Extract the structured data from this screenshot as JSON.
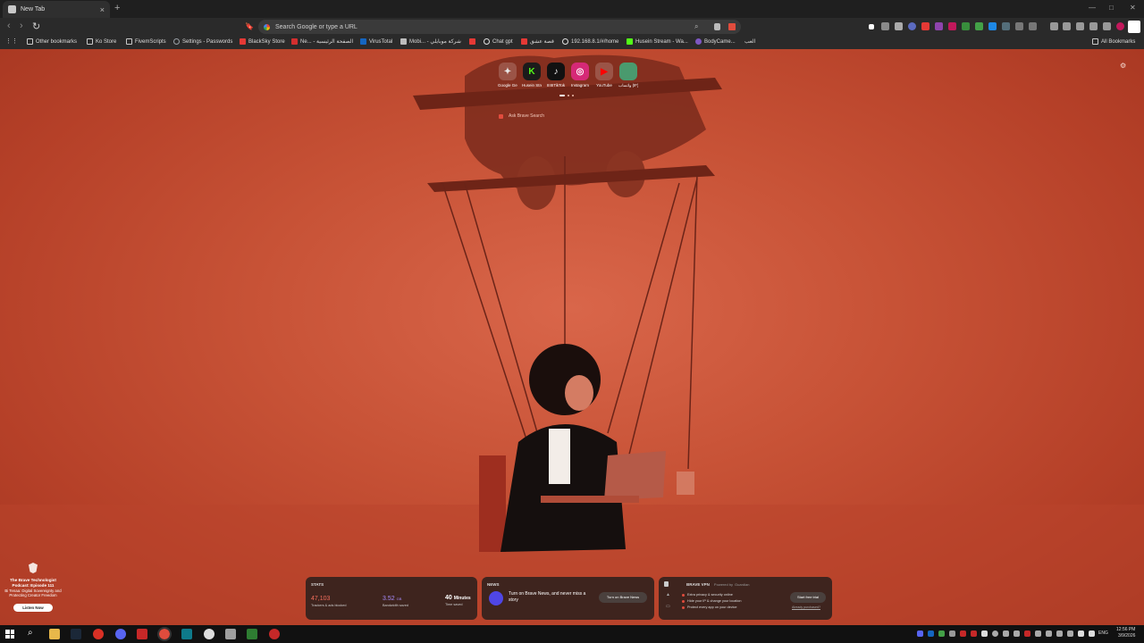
{
  "window": {
    "tab_title": "New Tab",
    "new_tab_symbol": "+",
    "close_symbol": "×",
    "min_symbol": "—",
    "max_symbol": "□",
    "win_close_symbol": "✕"
  },
  "toolbar": {
    "back_symbol": "‹",
    "forward_symbol": "›",
    "reload_symbol": "↻",
    "bookmark_symbol": "🔖",
    "omnibox_placeholder": "Search Google or type a URL"
  },
  "bookmarks": {
    "apps_symbol": "⋮⋮",
    "items": [
      {
        "label": "Other bookmarks",
        "color": "#c9c9c9"
      },
      {
        "label": "Ko Store",
        "color": "#c9c9c9"
      },
      {
        "label": "FivemScripts",
        "color": "#c9c9c9"
      },
      {
        "label": "Settings - Passwords",
        "color": "#9aa0a6"
      },
      {
        "label": "BlackSky Store",
        "color": "#e53935"
      },
      {
        "label": "Ne... - الصفحة الرئيسية",
        "color": "#d32f2f"
      },
      {
        "label": "VirusTotal",
        "color": "#1565c0"
      },
      {
        "label": "Mobi... - شركة موبايلي",
        "color": "#bdbdbd"
      },
      {
        "label": "",
        "color": "#e53935"
      },
      {
        "label": "Chat gpt",
        "color": "#e0e0e0"
      },
      {
        "label": "قصة عشق",
        "color": "#e53935"
      },
      {
        "label": "192.168.8.1/#/home",
        "color": "#e0e0e0"
      },
      {
        "label": "Husein Stream - Wa...",
        "color": "#53fc18"
      },
      {
        "label": "BodyCame...",
        "color": "#7e57c2"
      },
      {
        "label": "العب",
        "color": "#e0e0e0"
      }
    ],
    "all_bookmarks": "All Bookmarks"
  },
  "top_sites": [
    {
      "label": "Google Ge...",
      "glyph": "✦",
      "color": "#ffffff"
    },
    {
      "label": "Husein Stre...",
      "glyph": "K",
      "color": "#53fc18"
    },
    {
      "label": "IIIIIITikTok",
      "glyph": "♪",
      "color": "#111111"
    },
    {
      "label": "Instagram",
      "glyph": "◎",
      "color": "#d62976"
    },
    {
      "label": "YouTube",
      "glyph": "▶",
      "color": "#ff0000"
    },
    {
      "label": "واتساب (IF)",
      "glyph": "",
      "color": "#25d366"
    }
  ],
  "search": {
    "placeholder": "Ask Brave Search"
  },
  "stats": {
    "title": "STATS",
    "trackers_value": "47,103",
    "trackers_label": "Trackers & ads blocked",
    "bandwidth_value": "3.52",
    "bandwidth_unit": "GB",
    "bandwidth_label": "Bandwidth saved",
    "time_value": "40",
    "time_unit": "Minutes",
    "time_label": "Time saved"
  },
  "news": {
    "title": "NEWS",
    "text": "Turn on Brave News, and never miss a story",
    "button": "Turn on Brave News"
  },
  "vpn": {
    "title": "BRAVE VPN",
    "powered": "Powered by",
    "powered_brand": "Guardian",
    "features": [
      "Extra privacy & security online",
      "Hide your IP & change your location",
      "Protect every app on your device"
    ],
    "button": "Start free trial",
    "link": "Already purchased?"
  },
  "podcast": {
    "title": "The Brave Technologist Podcast: Episode 111",
    "desc": "Bi Tenaa: Digital Sovereignty and Protecting Creator Freedom",
    "button": "Listen Now"
  },
  "taskbar": {
    "lang": "ENG",
    "time": "12:56 PM",
    "date": "3/9/2026"
  }
}
